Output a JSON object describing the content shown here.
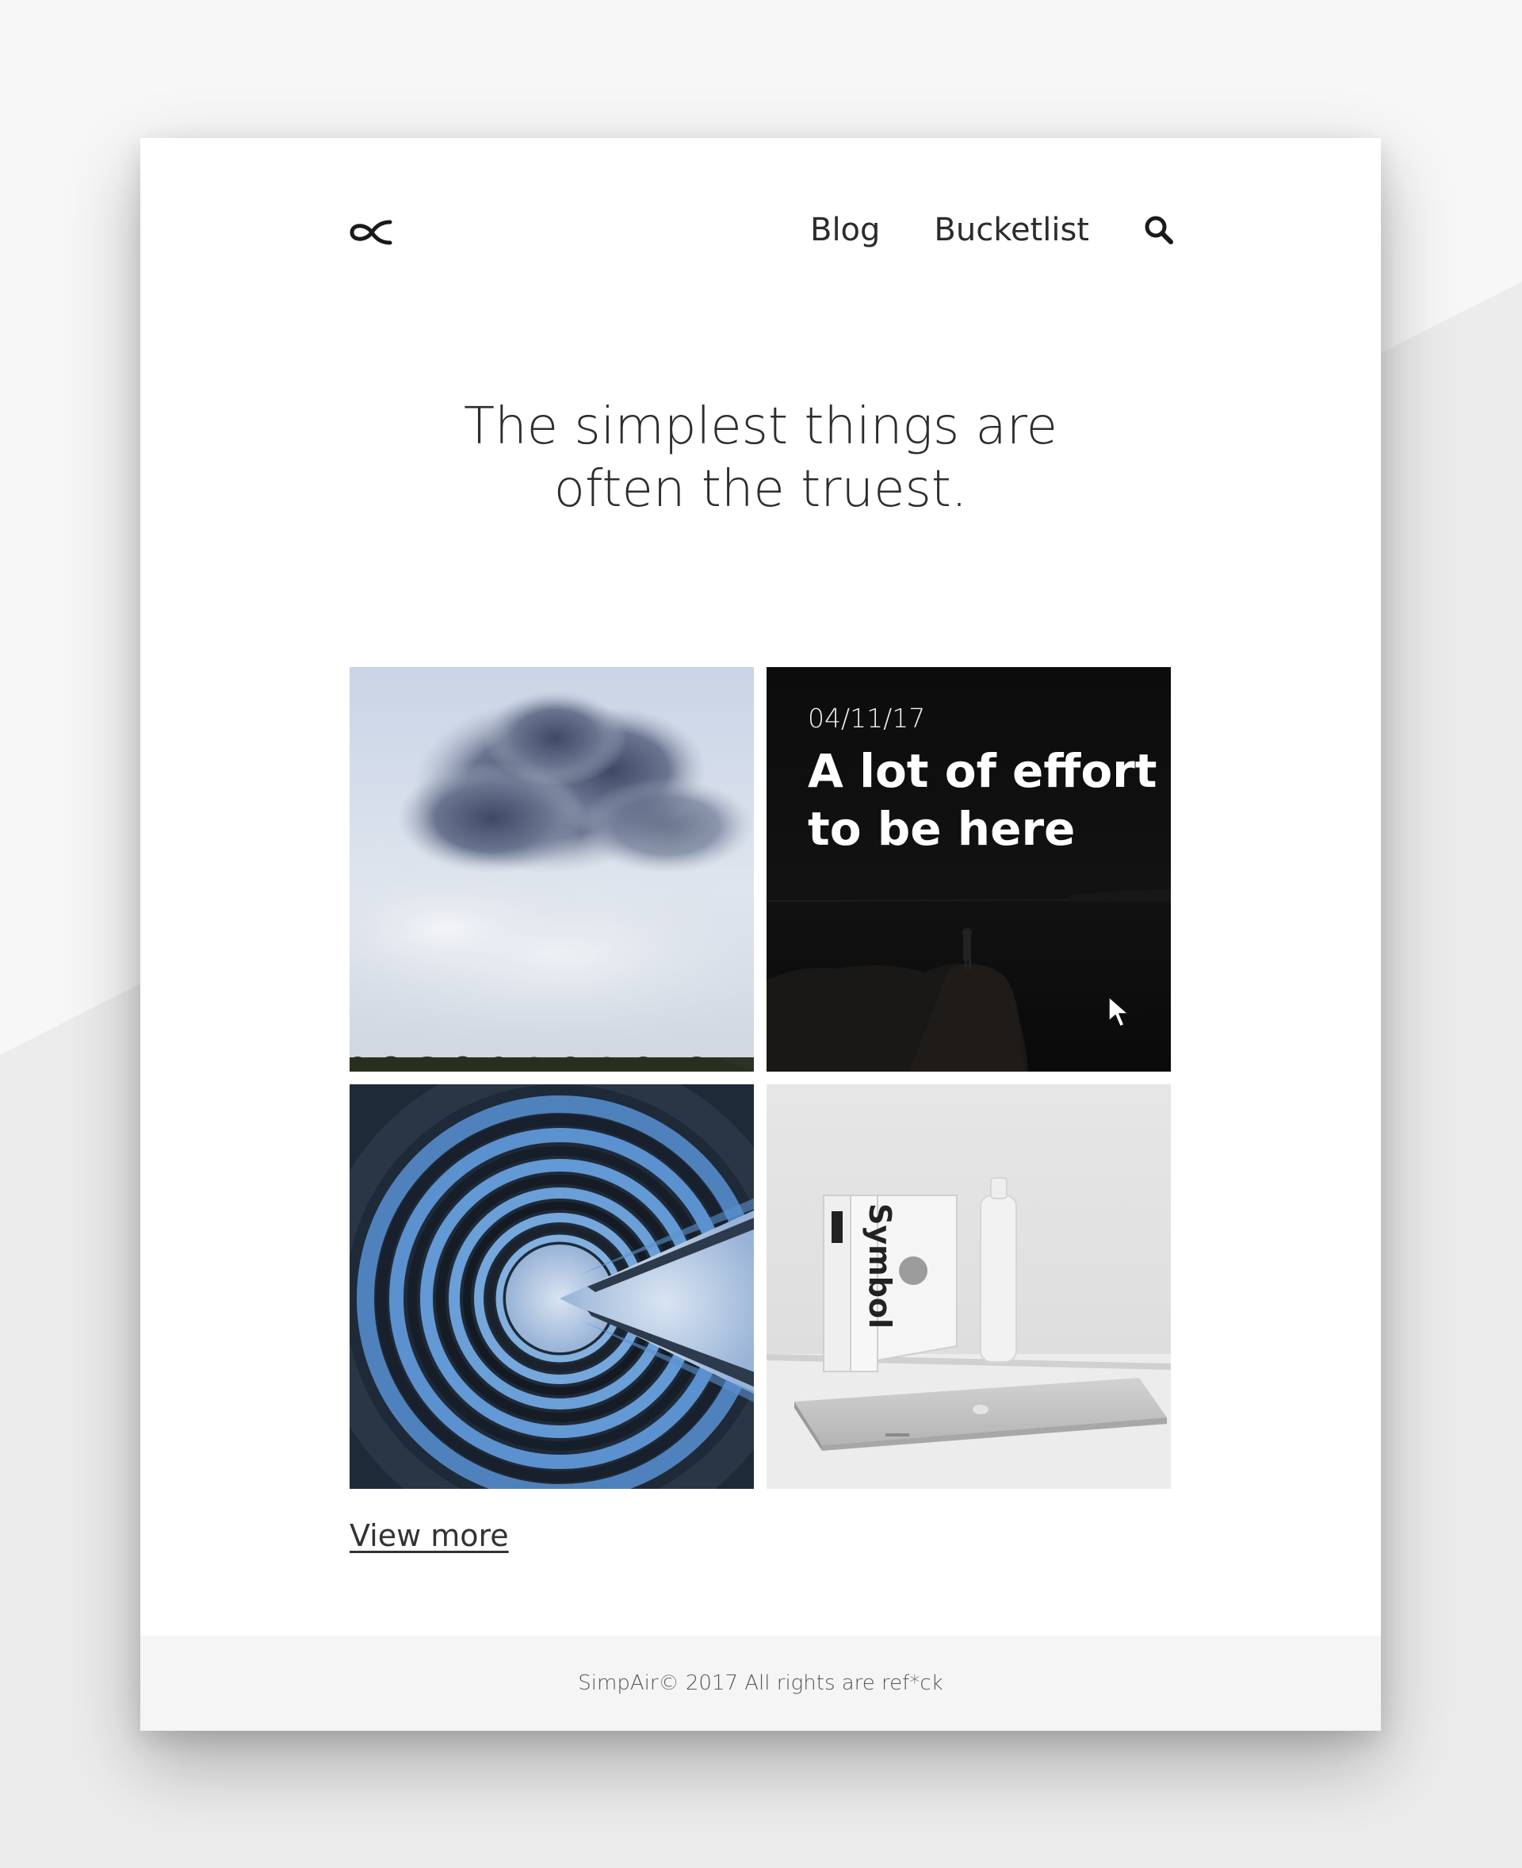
{
  "nav": {
    "logo_icon": "infinity-alpha-icon",
    "links": [
      {
        "label": "Blog"
      },
      {
        "label": "Bucketlist"
      }
    ],
    "search_icon": "search-icon"
  },
  "hero": {
    "line1": "The simplest things are",
    "line2": "often the truest."
  },
  "tiles": [
    {
      "image": "storm-cloud-photo"
    },
    {
      "image": "night-cliff-silhouette-photo",
      "date": "04/11/17",
      "title_line1": "A lot of effort",
      "title_line2": "to be here"
    },
    {
      "image": "spiral-building-photo"
    },
    {
      "image": "book-and-laptop-photo",
      "book_text": "Symbol"
    }
  ],
  "view_more": "View more",
  "footer": {
    "text": "SimpAir© 2017 All rights are ref*ck"
  },
  "colors": {
    "background": "#f4f4f5",
    "card": "#ffffff",
    "text": "#2d2d2d",
    "footer_bg": "#f5f5f5"
  }
}
